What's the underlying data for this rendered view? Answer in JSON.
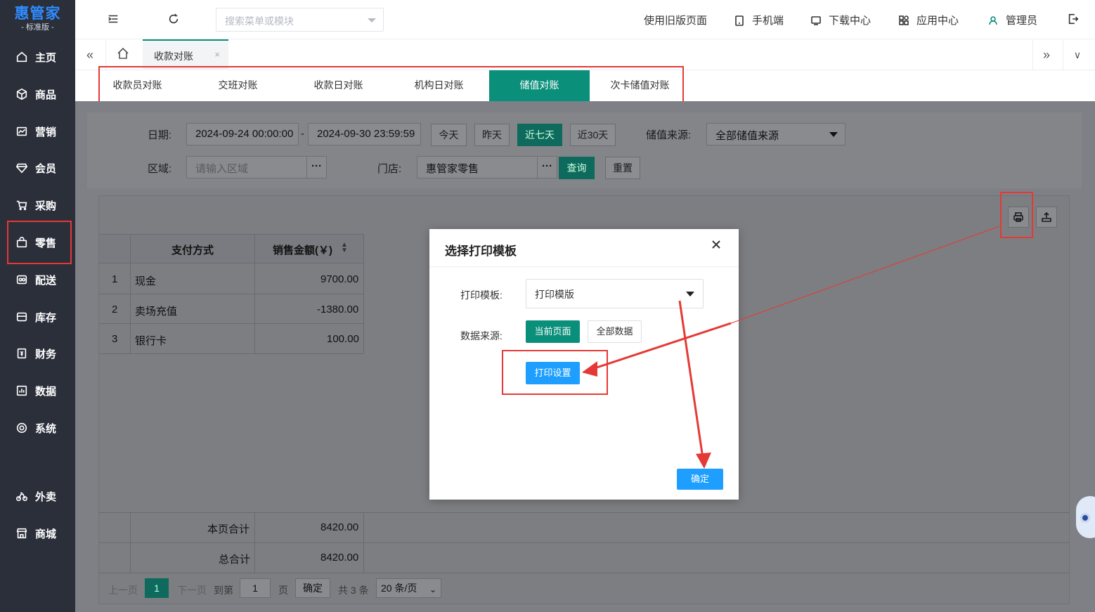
{
  "brand": {
    "name": "惠管家",
    "edition": "- 标准版 -"
  },
  "sidebar": {
    "items": [
      {
        "label": "主页",
        "icon": "home-icon"
      },
      {
        "label": "商品",
        "icon": "box-icon"
      },
      {
        "label": "营销",
        "icon": "chart-icon"
      },
      {
        "label": "会员",
        "icon": "diamond-icon"
      },
      {
        "label": "采购",
        "icon": "cart-icon"
      },
      {
        "label": "零售",
        "icon": "bag-icon"
      },
      {
        "label": "配送",
        "icon": "delivery-icon"
      },
      {
        "label": "库存",
        "icon": "storage-icon"
      },
      {
        "label": "财务",
        "icon": "finance-icon"
      },
      {
        "label": "数据",
        "icon": "data-icon"
      },
      {
        "label": "系统",
        "icon": "system-icon"
      },
      {
        "label": "外卖",
        "icon": "bike-icon"
      },
      {
        "label": "商城",
        "icon": "shop-icon"
      }
    ]
  },
  "topbar": {
    "search_placeholder": "搜索菜单或模块",
    "links": {
      "old_page": "使用旧版页面",
      "mobile": "手机端",
      "download": "下载中心",
      "apps": "应用中心",
      "user": "管理员"
    }
  },
  "tabbar": {
    "active_tab": "收款对账",
    "close": "×"
  },
  "subtabs": [
    "收款员对账",
    "交班对账",
    "收款日对账",
    "机构日对账",
    "储值对账",
    "次卡储值对账"
  ],
  "filters": {
    "date_label": "日期:",
    "date_start": "2024-09-24 00:00:00",
    "date_sep": "-",
    "date_end": "2024-09-30 23:59:59",
    "quick": [
      "今天",
      "昨天",
      "近七天",
      "近30天"
    ],
    "source_label": "储值来源:",
    "source_value": "全部储值来源",
    "region_label": "区域:",
    "region_placeholder": "请输入区域",
    "store_label": "门店:",
    "store_value": "惠管家零售",
    "query": "查询",
    "reset": "重置",
    "ellipsis": "···"
  },
  "table": {
    "headers": {
      "method": "支付方式",
      "amount": "销售金额(￥)"
    },
    "rows": [
      {
        "index": "1",
        "method": "现金",
        "amount": "9700.00"
      },
      {
        "index": "2",
        "method": "卖场充值",
        "amount": "-1380.00"
      },
      {
        "index": "3",
        "method": "银行卡",
        "amount": "100.00"
      }
    ],
    "page_total_label": "本页合计",
    "page_total": "8420.00",
    "grand_total_label": "总合计",
    "grand_total": "8420.00"
  },
  "pager": {
    "prev": "上一页",
    "current": "1",
    "next": "下一页",
    "goto": "到第",
    "goto_value": "1",
    "page_unit": "页",
    "confirm": "确定",
    "total": "共 3 条",
    "page_size": "20 条/页"
  },
  "modal": {
    "title": "选择打印模板",
    "template_label": "打印模板:",
    "template_value": "打印模版",
    "source_label": "数据来源:",
    "source_current": "当前页面",
    "source_all": "全部数据",
    "print_settings": "打印设置",
    "ok": "确定"
  },
  "colors": {
    "accent": "#0a8f7a",
    "sidebar": "#2b2f3a",
    "blue": "#1e9fff",
    "annotation": "#e53935"
  }
}
